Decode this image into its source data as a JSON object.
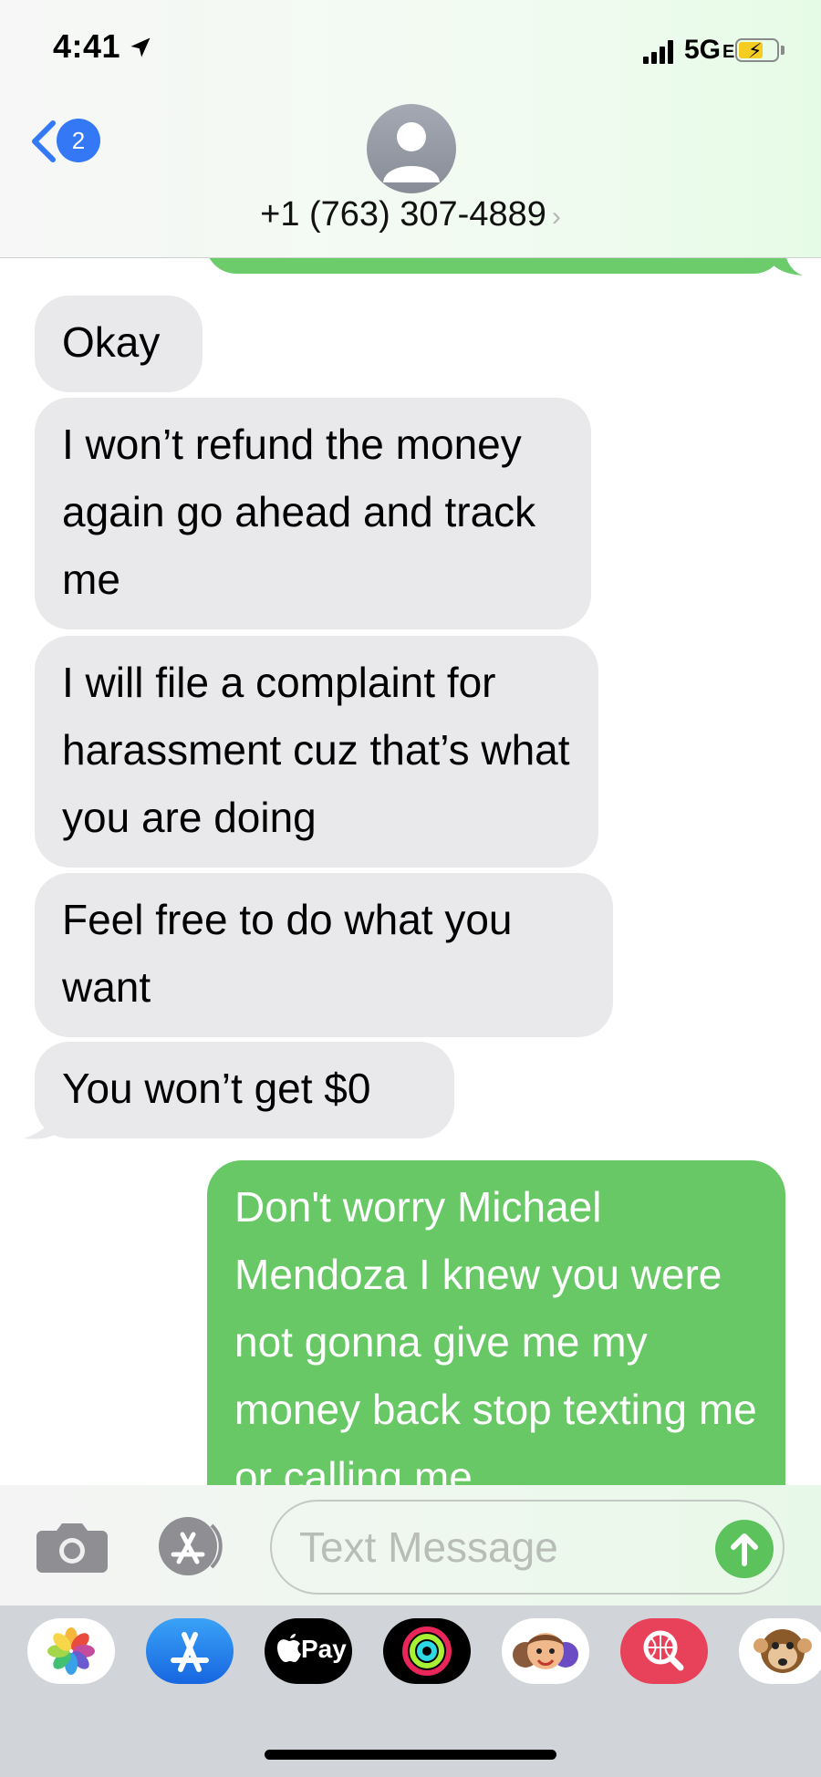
{
  "status_bar": {
    "time": "4:41",
    "network": "5G",
    "network_sub": "E"
  },
  "header": {
    "back_badge": "2",
    "contact": "+1 (763) 307-4889",
    "contact_chevron": "›"
  },
  "messages": [
    {
      "direction": "in",
      "text": "Okay"
    },
    {
      "direction": "in",
      "text": "I won’t refund the money again go ahead and track me"
    },
    {
      "direction": "in",
      "text": "I will file a complaint for harassment cuz that’s what you are doing"
    },
    {
      "direction": "in",
      "text": "Feel free to do what you want"
    },
    {
      "direction": "in",
      "text": "You won’t get $0"
    },
    {
      "direction": "out",
      "text": "Don't worry Michael Mendoza I knew you were not gonna give me my money back stop texting me or calling me"
    }
  ],
  "composer": {
    "placeholder": "Text Message"
  },
  "app_strip": {
    "apple_pay_label": "Pay",
    "apps": [
      "photos-icon",
      "app-store-icon",
      "apple-pay-icon",
      "activity-icon",
      "memoji-icon",
      "web-search-icon",
      "animoji-icon"
    ]
  },
  "colors": {
    "sent_bubble": "#67c865",
    "received_bubble": "#e9e9eb",
    "accent_blue": "#3478f6"
  }
}
